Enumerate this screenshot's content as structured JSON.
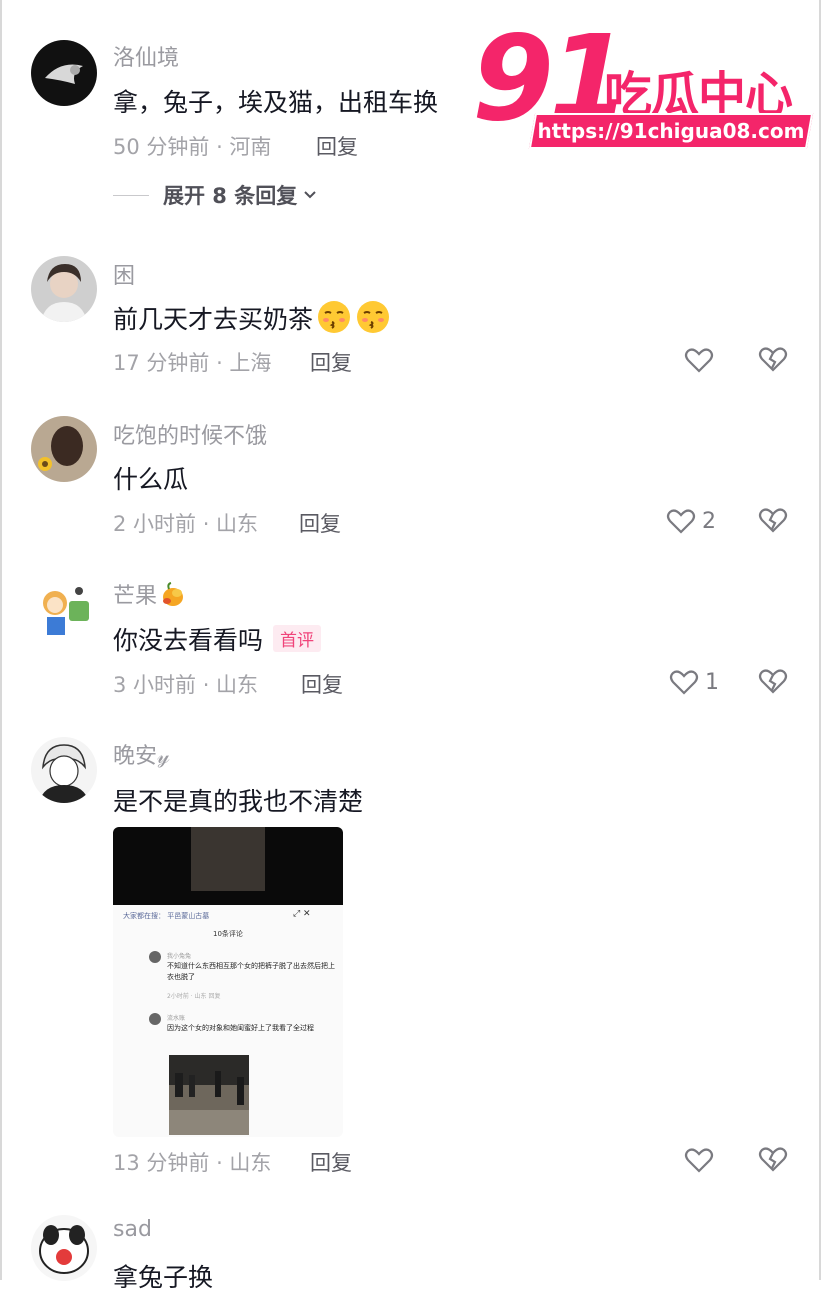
{
  "watermark": {
    "number": "91",
    "brand": "吃瓜中心",
    "url": "https://91chigua08.com"
  },
  "comments": [
    {
      "username": "洛仙境",
      "text": "拿，兔子，埃及猫，出租车换",
      "meta": "50 分钟前 · 河南",
      "reply": "回复"
    },
    {
      "username": "困",
      "text": "前几天才去买奶茶",
      "emoji": [
        "kissing-face-emoji",
        "kissing-face-emoji"
      ],
      "meta": "17 分钟前 · 上海",
      "reply": "回复"
    },
    {
      "username": "吃饱的时候不饿",
      "text": "什么瓜",
      "meta": "2 小时前 · 山东",
      "reply": "回复",
      "likes": "2"
    },
    {
      "username": "芒果",
      "username_emoji": "mango-emoji",
      "text": "你没去看看吗",
      "tag": "首评",
      "meta": "3 小时前 · 山东",
      "reply": "回复",
      "likes": "1"
    },
    {
      "username": "晚安𝓎",
      "text": "是不是真的我也不清楚",
      "meta": "13 分钟前 · 山东",
      "reply": "回复"
    },
    {
      "username": "sad",
      "text": "拿兔子换"
    }
  ],
  "expand_replies": "展开 8 条回复",
  "embedded_screenshot": {
    "search_text": "大家都在搜： 平邑蒙山古墓",
    "comment_count": "10条评论",
    "comment1_name": "我小兔兔",
    "comment1_text": "不知道什么东西相互那个女的把裤子脱了出去然后把上衣也脱了",
    "comment1_meta": "2小时前 · 山东    回复",
    "comment2_name": "流水账",
    "comment2_text": "因为这个女的对象和她闺蜜好上了我看了全过程"
  },
  "colors": {
    "accent_pink": "#f4256a",
    "tag_pink": "#f0447a",
    "meta_gray": "#a3a3a8",
    "text_dark": "#161823"
  }
}
